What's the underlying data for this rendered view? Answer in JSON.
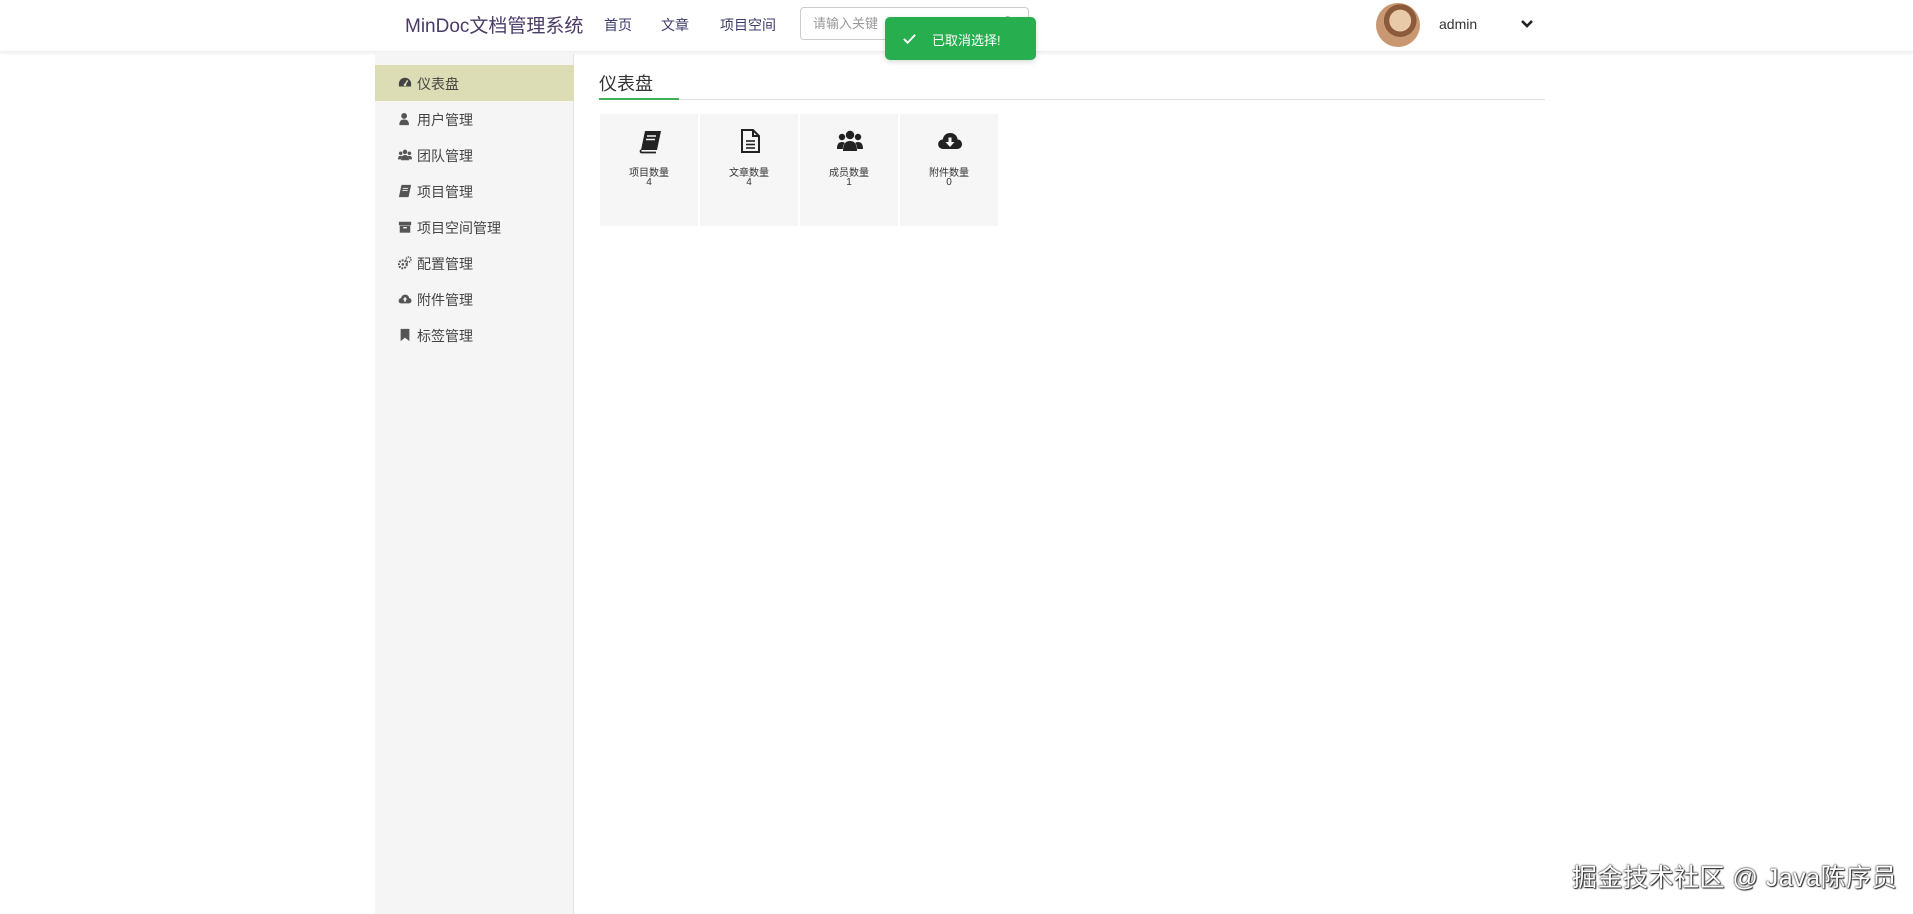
{
  "header": {
    "brand": "MinDoc文档管理系统",
    "nav": [
      "首页",
      "文章",
      "项目空间"
    ],
    "search_placeholder": "请输入关键",
    "username": "admin"
  },
  "toast": {
    "message": "已取消选择!",
    "color": "#27ae4f"
  },
  "sidebar": {
    "items": [
      {
        "label": "仪表盘",
        "icon": "dashboard-icon",
        "active": true
      },
      {
        "label": "用户管理",
        "icon": "user-icon"
      },
      {
        "label": "团队管理",
        "icon": "users-icon"
      },
      {
        "label": "项目管理",
        "icon": "book-icon"
      },
      {
        "label": "项目空间管理",
        "icon": "archive-icon"
      },
      {
        "label": "配置管理",
        "icon": "cogs-icon"
      },
      {
        "label": "附件管理",
        "icon": "cloud-upload-icon"
      },
      {
        "label": "标签管理",
        "icon": "bookmark-icon"
      }
    ],
    "active_color": "#dcdcb5"
  },
  "main": {
    "title": "仪表盘",
    "accent": "#3fae55",
    "cards": [
      {
        "label": "项目数量",
        "value": "4",
        "icon": "book-icon"
      },
      {
        "label": "文章数量",
        "value": "4",
        "icon": "file-text-icon"
      },
      {
        "label": "成员数量",
        "value": "1",
        "icon": "users-icon"
      },
      {
        "label": "附件数量",
        "value": "0",
        "icon": "cloud-download-icon"
      }
    ]
  },
  "watermark": "掘金技术社区 @ Java陈序员"
}
